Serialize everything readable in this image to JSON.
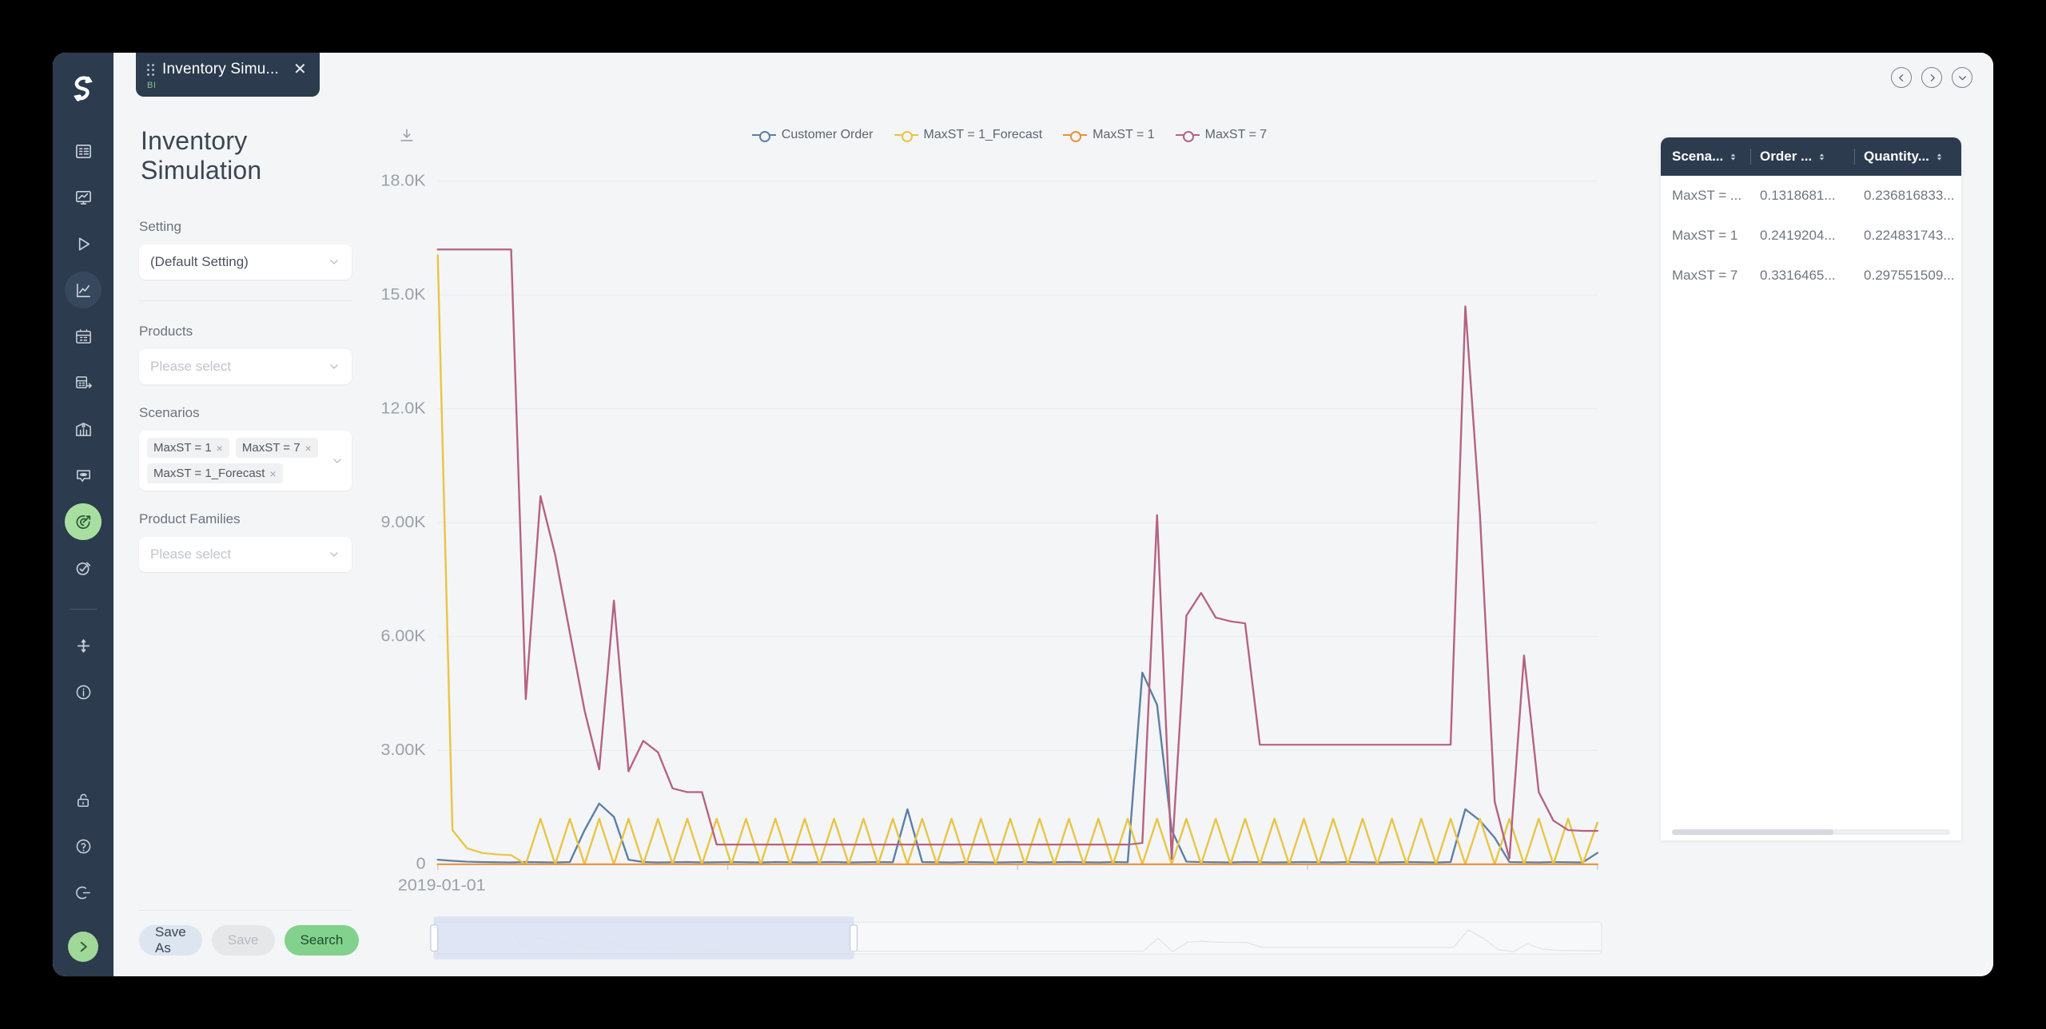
{
  "window": {
    "controls": [
      {
        "name": "nav-back",
        "icon": "chevron-left-icon"
      },
      {
        "name": "nav-forward",
        "icon": "chevron-right-icon"
      },
      {
        "name": "nav-more",
        "icon": "chevron-down-icon"
      }
    ]
  },
  "tab": {
    "title": "Inventory Simu...",
    "badge": "BI",
    "close": "✕"
  },
  "sidebar": {
    "logo": "s-logo-icon",
    "items": [
      {
        "name": "sidebar-item-overview",
        "icon": "list-panel-icon",
        "state": "normal"
      },
      {
        "name": "sidebar-item-dashboard",
        "icon": "monitor-chart-icon",
        "state": "normal"
      },
      {
        "name": "sidebar-item-run",
        "icon": "play-icon",
        "state": "normal"
      },
      {
        "name": "sidebar-item-analytics",
        "icon": "line-chart-icon",
        "state": "dim"
      },
      {
        "name": "sidebar-item-calendar",
        "icon": "calendar-grid-icon",
        "state": "normal"
      },
      {
        "name": "sidebar-item-import",
        "icon": "calendar-import-icon",
        "state": "normal"
      },
      {
        "name": "sidebar-item-warehouse",
        "icon": "warehouse-icon",
        "state": "normal"
      },
      {
        "name": "sidebar-item-insight",
        "icon": "speech-eye-icon",
        "state": "normal"
      },
      {
        "name": "sidebar-item-simulation",
        "icon": "target-arrow-icon",
        "state": "active"
      },
      {
        "name": "sidebar-item-optimize",
        "icon": "target-check-icon",
        "state": "normal"
      }
    ],
    "tools": [
      {
        "name": "sidebar-item-add",
        "icon": "plus-icon"
      },
      {
        "name": "sidebar-item-info",
        "icon": "info-circle-icon"
      }
    ],
    "bottom": [
      {
        "name": "sidebar-item-lock",
        "icon": "lock-icon"
      },
      {
        "name": "sidebar-item-help",
        "icon": "question-circle-icon"
      },
      {
        "name": "sidebar-item-logout",
        "icon": "logout-icon"
      }
    ],
    "expand": {
      "name": "sidebar-expand",
      "icon": "chevron-right-icon"
    }
  },
  "page": {
    "title": "Inventory Simulation"
  },
  "filters": {
    "setting": {
      "label": "Setting",
      "value": "(Default Setting)"
    },
    "products": {
      "label": "Products",
      "placeholder": "Please select",
      "value": ""
    },
    "scenarios": {
      "label": "Scenarios",
      "tags": [
        "MaxST = 1",
        "MaxST = 7",
        "MaxST = 1_Forecast"
      ],
      "remove": "×"
    },
    "product_families": {
      "label": "Product Families",
      "placeholder": "Please select",
      "value": ""
    },
    "actions": {
      "save_as": "Save As",
      "save": "Save",
      "search": "Search"
    }
  },
  "chart_toolbar": {
    "download": "download-icon"
  },
  "chart_data": {
    "type": "line",
    "title": "",
    "xlabel": "",
    "ylabel": "",
    "grid": true,
    "legend_position": "top",
    "ylim": [
      0,
      18000
    ],
    "ytick_labels": [
      "18.0K",
      "15.0K",
      "12.0K",
      "9.00K",
      "6.00K",
      "3.00K",
      "0"
    ],
    "ytick_values": [
      18000,
      15000,
      12000,
      9000,
      6000,
      3000,
      0
    ],
    "xtick_labels": [
      "2019-01-01"
    ],
    "x_start": "2019-01-01",
    "colors": {
      "Customer Order": "#5b7fa6",
      "MaxST = 1_Forecast": "#e8c544",
      "MaxST = 1": "#e8913c",
      "MaxST = 7": "#b5637f"
    },
    "series": [
      {
        "name": "Customer Order",
        "color": "#5b7fa6",
        "values": [
          120,
          90,
          70,
          60,
          55,
          50,
          60,
          55,
          50,
          60,
          900,
          1600,
          1250,
          120,
          60,
          50,
          55,
          60,
          50,
          55,
          60,
          55,
          50,
          60,
          55,
          50,
          55,
          60,
          50,
          55,
          60,
          55,
          1450,
          60,
          55,
          50,
          60,
          55,
          50,
          55,
          60,
          50,
          55,
          60,
          55,
          50,
          60,
          55,
          5050,
          4200,
          900,
          70,
          60,
          55,
          50,
          60,
          55,
          50,
          55,
          60,
          55,
          50,
          60,
          55,
          50,
          55,
          60,
          55,
          50,
          60,
          1450,
          1150,
          700,
          60,
          55,
          50,
          60,
          55,
          50,
          300
        ]
      },
      {
        "name": "MaxST = 1_Forecast",
        "color": "#e8c544",
        "values": [
          16050,
          900,
          420,
          300,
          260,
          240,
          0,
          1200,
          0,
          1200,
          0,
          1200,
          0,
          1200,
          0,
          1200,
          0,
          1200,
          0,
          1200,
          0,
          1200,
          0,
          1200,
          0,
          1200,
          0,
          1200,
          0,
          1200,
          0,
          1200,
          0,
          1200,
          0,
          1200,
          0,
          1200,
          0,
          1200,
          0,
          1200,
          0,
          1200,
          0,
          1200,
          0,
          1200,
          0,
          1200,
          0,
          1200,
          0,
          1200,
          0,
          1200,
          0,
          1200,
          0,
          1200,
          0,
          1200,
          0,
          1200,
          0,
          1200,
          0,
          1200,
          0,
          1200,
          0,
          1200,
          0,
          1200,
          0,
          1200,
          0,
          1200,
          0,
          1100
        ]
      },
      {
        "name": "MaxST = 1",
        "color": "#e8913c",
        "values": [
          0,
          0,
          0,
          0,
          0,
          0,
          0,
          0,
          0,
          0,
          0,
          0,
          0,
          0,
          0,
          0,
          0,
          0,
          0,
          0,
          0,
          0,
          0,
          0,
          0,
          0,
          0,
          0,
          0,
          0,
          0,
          0,
          0,
          0,
          0,
          0,
          0,
          0,
          0,
          0,
          0,
          0,
          0,
          0,
          0,
          0,
          0,
          0,
          0,
          0,
          0,
          0,
          0,
          0,
          0,
          0,
          0,
          0,
          0,
          0,
          0,
          0,
          0,
          0,
          0,
          0,
          0,
          0,
          0,
          0,
          0,
          0,
          0,
          0,
          0,
          0,
          0,
          0,
          0,
          0
        ]
      },
      {
        "name": "MaxST = 7",
        "color": "#b5637f",
        "values": [
          16200,
          16200,
          16200,
          16200,
          16200,
          16200,
          4350,
          9700,
          8150,
          6100,
          4050,
          2500,
          6950,
          2450,
          3250,
          2950,
          2000,
          1900,
          1900,
          520,
          520,
          520,
          520,
          520,
          520,
          520,
          520,
          520,
          520,
          520,
          520,
          520,
          520,
          520,
          520,
          520,
          520,
          520,
          520,
          520,
          520,
          520,
          520,
          520,
          520,
          520,
          520,
          520,
          560,
          9200,
          140,
          6550,
          7150,
          6500,
          6400,
          6350,
          3150,
          3150,
          3150,
          3150,
          3150,
          3150,
          3150,
          3150,
          3150,
          3150,
          3150,
          3150,
          3150,
          3150,
          14700,
          9200,
          1650,
          150,
          5500,
          1900,
          1150,
          900,
          880,
          880
        ]
      }
    ]
  },
  "data_zoom": {
    "start_percent": 0,
    "end_percent": 36
  },
  "table": {
    "columns": [
      {
        "label": "Scena...",
        "name": "column-scenario"
      },
      {
        "label": "Order ...",
        "name": "column-order"
      },
      {
        "label": "Quantity...",
        "name": "column-quantity"
      }
    ],
    "rows": [
      {
        "scenario": "MaxST = ...",
        "order": "0.1318681...",
        "quantity": "0.236816833..."
      },
      {
        "scenario": "MaxST = 1",
        "order": "0.2419204...",
        "quantity": "0.224831743..."
      },
      {
        "scenario": "MaxST = 7",
        "order": "0.3316465...",
        "quantity": "0.297551509..."
      }
    ]
  }
}
